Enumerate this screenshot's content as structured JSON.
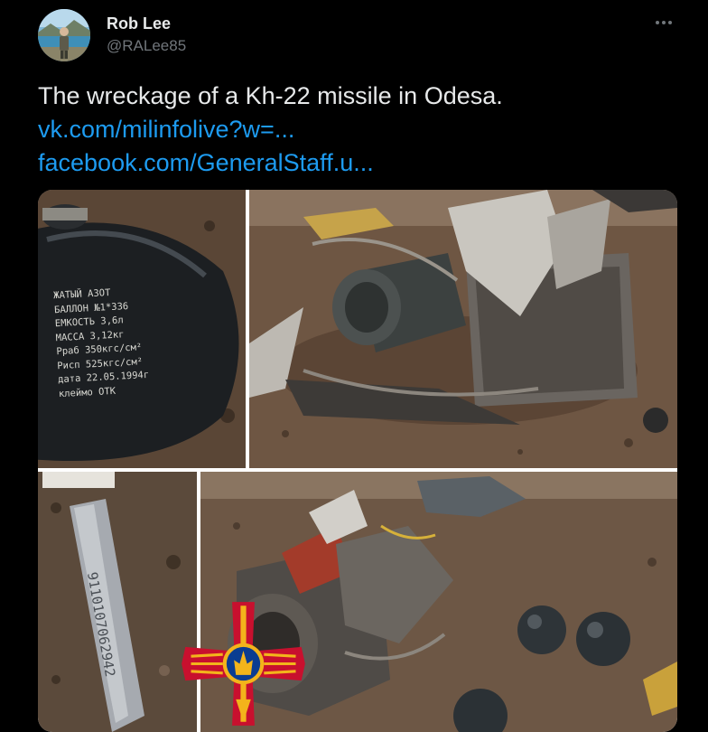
{
  "author": {
    "display_name": "Rob Lee",
    "handle": "@RALee85",
    "avatar_icon": "profile-photo"
  },
  "more_icon": "more-horizontal-icon",
  "tweet": {
    "text": "The wreckage of a Kh-22 missile in Odesa.",
    "links": [
      "vk.com/milinfolive?w=...",
      "facebook.com/GeneralStaff.u..."
    ]
  },
  "media": {
    "stenciled_text": [
      "ЖАТЫЙ АЗОТ",
      "БАЛЛОН №1*336",
      "ЕМКОСТЬ 3,6л",
      "МАССА 3,12кг",
      "Рраб 350кгс/см²",
      "Рисп 525кгс/см²",
      "дата 22.05.1994г",
      "клеймо ОТК"
    ],
    "serial_number": "9110107062942",
    "emblem_icon": "ukrainian-armed-forces-emblem-icon"
  },
  "colors": {
    "background": "#000000",
    "text": "#e7e9ea",
    "secondary": "#71767b",
    "link": "#1d9bf0",
    "emblem_red": "#c8102e",
    "emblem_gold": "#f3b41b",
    "emblem_blue": "#0b3d91"
  }
}
